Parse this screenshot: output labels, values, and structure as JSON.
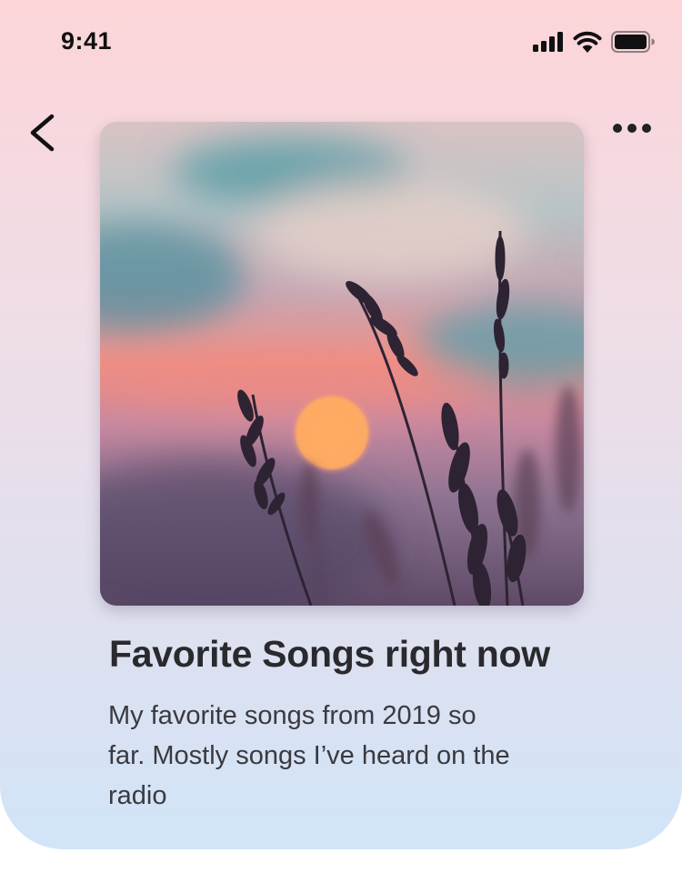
{
  "status_bar": {
    "time": "9:41",
    "icons": [
      "cellular-signal-icon",
      "wifi-icon",
      "battery-icon"
    ]
  },
  "nav": {
    "back_icon": "chevron-left-icon",
    "more_icon": "more-horizontal-icon"
  },
  "playlist": {
    "cover_image": "sunset-wheat-artwork",
    "title": "Favorite Songs right now",
    "description": "My favorite songs from 2019 so far. Mostly songs I’ve heard on the radio"
  },
  "colors": {
    "gradient_top": "#fcd5d8",
    "gradient_bottom": "#d1e4f8",
    "title_text": "#2a2a2e",
    "body_text": "#3a3a40"
  }
}
